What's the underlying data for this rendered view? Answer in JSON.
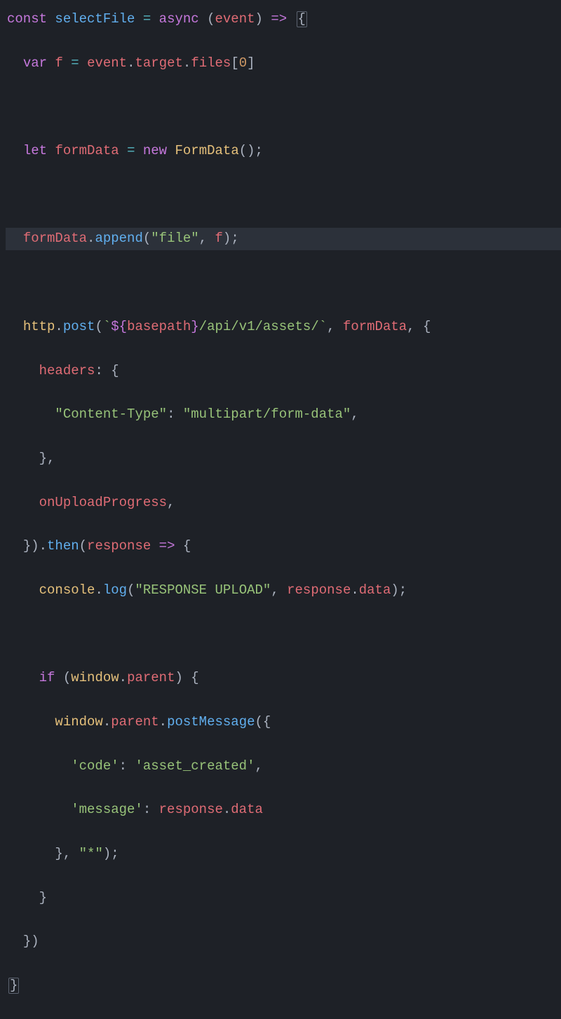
{
  "code": {
    "l1": {
      "const": "const",
      "sp1": " ",
      "name": "selectFile",
      "sp2": " ",
      "eq": "=",
      "sp3": " ",
      "async": "async",
      "sp4": " ",
      "lp": "(",
      "event": "event",
      "rp": ")",
      "sp5": " ",
      "arrow": "=>",
      "sp6": " ",
      "brace": "{"
    },
    "l2": {
      "indent": "  ",
      "var": "var",
      "sp1": " ",
      "f": "f",
      "sp2": " ",
      "eq": "=",
      "sp3": " ",
      "event": "event",
      "dot1": ".",
      "target": "target",
      "dot2": ".",
      "files": "files",
      "lb": "[",
      "zero": "0",
      "rb": "]"
    },
    "l4": {
      "indent": "  ",
      "let": "let",
      "sp1": " ",
      "formData": "formData",
      "sp2": " ",
      "eq": "=",
      "sp3": " ",
      "new": "new",
      "sp4": " ",
      "FormData": "FormData",
      "lp": "(",
      "rp": ")",
      "semi": ";"
    },
    "l6": {
      "indent": "  ",
      "formData": "formData",
      "dot": ".",
      "append": "append",
      "lp": "(",
      "file": "\"file\"",
      "comma": ",",
      "sp": " ",
      "f": "f",
      "rp": ")",
      "semi": ";"
    },
    "l8": {
      "indent": "  ",
      "http": "http",
      "dot": ".",
      "post": "post",
      "lp": "(",
      "bt1": "`",
      "interpOpen": "${",
      "basepath": "basepath",
      "interpClose": "}",
      "path": "/api/v1/assets/",
      "bt2": "`",
      "comma1": ",",
      "sp1": " ",
      "formData": "formData",
      "comma2": ",",
      "sp2": " ",
      "brace": "{"
    },
    "l9": {
      "indent": "    ",
      "headers": "headers",
      "colon": ":",
      "sp": " ",
      "brace": "{"
    },
    "l10": {
      "indent": "      ",
      "key": "\"Content-Type\"",
      "colon": ":",
      "sp": " ",
      "val": "\"multipart/form-data\"",
      "comma": ","
    },
    "l11": {
      "indent": "    ",
      "brace": "}",
      "comma": ","
    },
    "l12": {
      "indent": "    ",
      "onUploadProgress": "onUploadProgress",
      "comma": ","
    },
    "l13": {
      "indent": "  ",
      "brace": "}",
      "rp": ")",
      "dot": ".",
      "then": "then",
      "lp": "(",
      "response": "response",
      "sp": " ",
      "arrow": "=>",
      "sp2": " ",
      "brace2": "{"
    },
    "l14": {
      "indent": "    ",
      "console": "console",
      "dot": ".",
      "log": "log",
      "lp": "(",
      "msg": "\"RESPONSE UPLOAD\"",
      "comma": ",",
      "sp": " ",
      "response": "response",
      "dot2": ".",
      "data": "data",
      "rp": ")",
      "semi": ";"
    },
    "l16": {
      "indent": "    ",
      "if": "if",
      "sp": " ",
      "lp": "(",
      "window": "window",
      "dot": ".",
      "parent": "parent",
      "rp": ")",
      "sp2": " ",
      "brace": "{"
    },
    "l17": {
      "indent": "      ",
      "window": "window",
      "dot": ".",
      "parent": "parent",
      "dot2": ".",
      "postMessage": "postMessage",
      "lp": "(",
      "brace": "{"
    },
    "l18": {
      "indent": "        ",
      "key": "'code'",
      "colon": ":",
      "sp": " ",
      "val": "'asset_created'",
      "comma": ","
    },
    "l19": {
      "indent": "        ",
      "key": "'message'",
      "colon": ":",
      "sp": " ",
      "response": "response",
      "dot": ".",
      "data": "data"
    },
    "l20": {
      "indent": "      ",
      "brace": "}",
      "comma": ",",
      "sp": " ",
      "star": "\"*\"",
      "rp": ")",
      "semi": ";"
    },
    "l21": {
      "indent": "    ",
      "brace": "}"
    },
    "l22": {
      "indent": "  ",
      "brace": "}",
      "rp": ")"
    },
    "l23": {
      "brace": "}"
    }
  }
}
